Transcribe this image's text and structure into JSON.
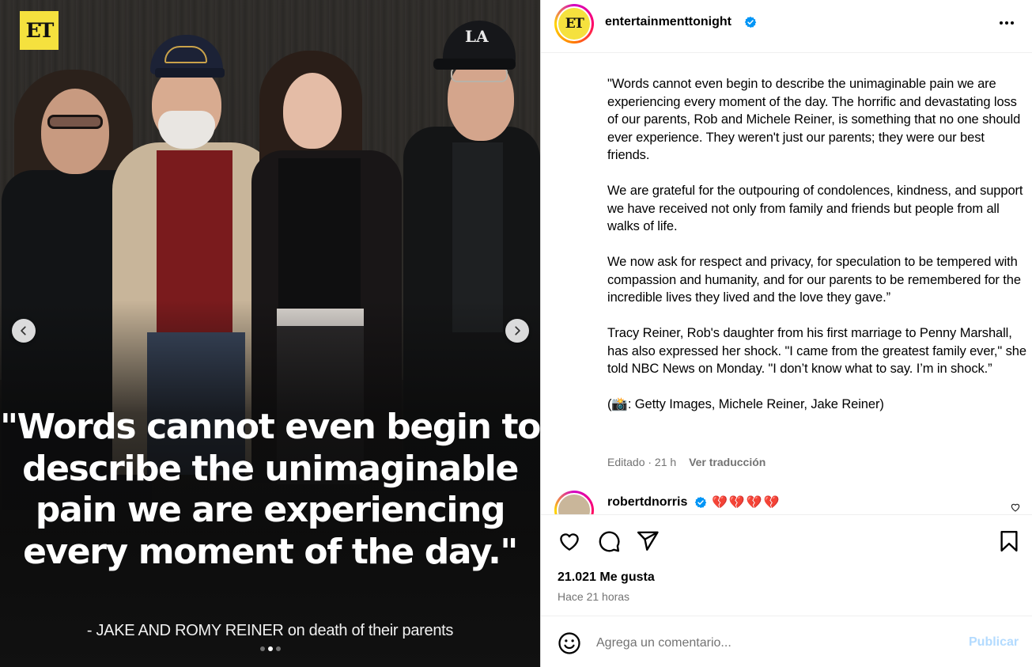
{
  "media": {
    "brand_logo": "ET",
    "overlay_quote": "\"Words cannot even begin to describe the unimaginable pain we are experiencing every moment of the day.\"",
    "overlay_attribution": "- JAKE AND ROMY REINER on death of their parents",
    "carousel": {
      "count": 3,
      "active_index": 1
    },
    "cap_logo": "LA"
  },
  "post": {
    "avatar_text": "ET",
    "username": "entertainmenttonight",
    "verified": true,
    "caption": [
      "\"Words cannot even begin to describe the unimaginable pain we are experiencing every moment of the day. The horrific and devastating loss of our parents, Rob and Michele Reiner, is something that no one should ever experience. They weren't just our parents; they were our best friends.",
      "We are grateful for the outpouring of condolences, kindness, and support we have received not only from family and friends but people from all walks of life.",
      "We now ask for respect and privacy, for speculation to be tempered with compassion and humanity, and for our parents to be remembered for the incredible lives they lived and the love they gave.”",
      "Tracy Reiner, Rob's daughter from his first marriage to Penny Marshall, has also expressed her shock. \"I came from the greatest family ever,\" she told NBC News on Monday. \"I don’t know what to say. I’m in shock.”",
      "(📸: Getty Images, Michele Reiner, Jake Reiner)"
    ],
    "edited_label": "Editado · 21 h",
    "translate_label": "Ver traducción"
  },
  "comment": {
    "username": "robertdnorris",
    "verified": true,
    "text": "💔💔💔💔"
  },
  "actions": {
    "likes": "21.021 Me gusta",
    "timestamp": "Hace 21 horas"
  },
  "composer": {
    "placeholder": "Agrega un comentario...",
    "publish_label": "Publicar"
  },
  "colors": {
    "et_yellow": "#f5e13e",
    "verified_blue": "#0095f6",
    "publish_disabled": "#b3dbff",
    "muted_text": "#737373"
  }
}
